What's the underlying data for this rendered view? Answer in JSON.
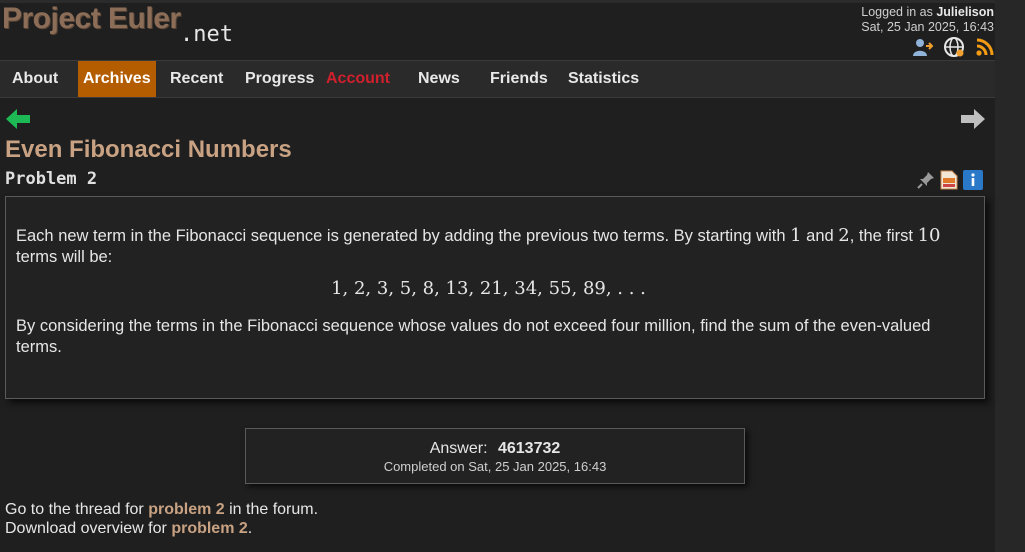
{
  "header": {
    "logo_main": "Project Euler",
    "logo_suffix": ".net",
    "logged_in_prefix": "Logged in as",
    "username": "Julielison",
    "datetime": "Sat, 25 Jan 2025, 16:43",
    "icons": [
      "account-icon",
      "globe-icon",
      "rss-icon"
    ]
  },
  "nav": {
    "items": [
      {
        "label": "About"
      },
      {
        "label": "Archives"
      },
      {
        "label": "Recent"
      },
      {
        "label": "Progress"
      },
      {
        "label": "Account"
      },
      {
        "label": "News"
      },
      {
        "label": "Friends"
      },
      {
        "label": "Statistics"
      }
    ],
    "active": "Archives",
    "active_color": "#b35c00",
    "account_color": "#d0202c"
  },
  "problem": {
    "title": "Even Fibonacci Numbers",
    "number_label": "Problem 2",
    "para1_a": "Each new term in the Fibonacci sequence is generated by adding the previous two terms. By starting with",
    "num_1": "1",
    "and_word": "and",
    "num_2": "2",
    "para1_b": ", the first",
    "num_10": "10",
    "para1_c": "terms will be:",
    "sequence": "1, 2, 3, 5, 8, 13, 21, 34, 55, 89, . . .",
    "para2": "By considering the terms in the Fibonacci sequence whose values do not exceed four million, find the sum of the even-valued terms."
  },
  "answer": {
    "label": "Answer:",
    "value": "4613732",
    "completed": "Completed on Sat, 25 Jan 2025, 16:43"
  },
  "footer": {
    "line1_a": "Go to the thread for",
    "line1_link": "problem 2",
    "line1_b": "in the forum.",
    "line2_a": "Download overview for",
    "line2_link": "problem 2",
    "line2_b": "."
  },
  "colors": {
    "background": "#1f1f20",
    "title": "#c8a282",
    "logo": "#8c6e58",
    "prev_arrow": "#1db954",
    "next_arrow": "#bfbfbf"
  }
}
